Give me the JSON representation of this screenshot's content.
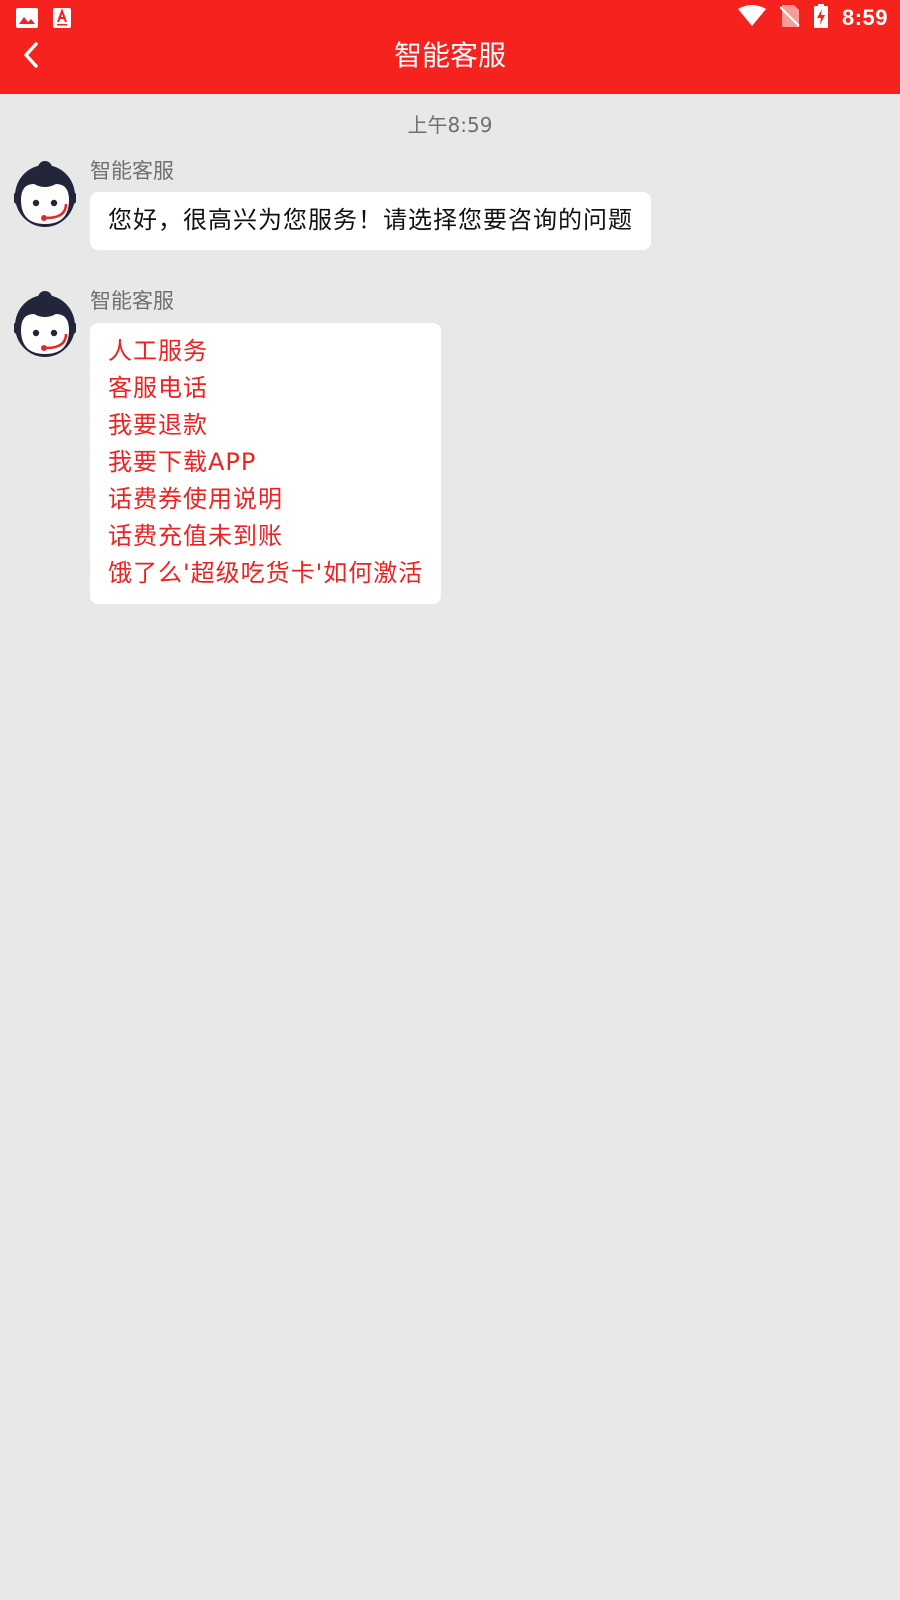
{
  "status_bar": {
    "time": "8:59",
    "left_icons": [
      "image-icon",
      "app-a-icon"
    ],
    "right_icons": [
      "wifi-icon",
      "no-sim-icon",
      "battery-charging-icon"
    ]
  },
  "toolbar": {
    "title": "智能客服",
    "back_icon": "chevron-left-icon",
    "background_color": "#f6221d"
  },
  "chat": {
    "timestamp": "上午8:59",
    "messages": [
      {
        "sender": "智能客服",
        "text": "您好，很高兴为您服务！请选择您要咨询的问题"
      },
      {
        "sender": "智能客服",
        "options": [
          "人工服务",
          "客服电话",
          "我要退款",
          "我要下载APP",
          "话费券使用说明",
          "话费充值未到账",
          "饿了么'超级吃货卡'如何激活"
        ]
      }
    ]
  },
  "colors": {
    "accent": "#f6221d",
    "option_text": "#ee2222",
    "background": "#e8e8e8"
  }
}
